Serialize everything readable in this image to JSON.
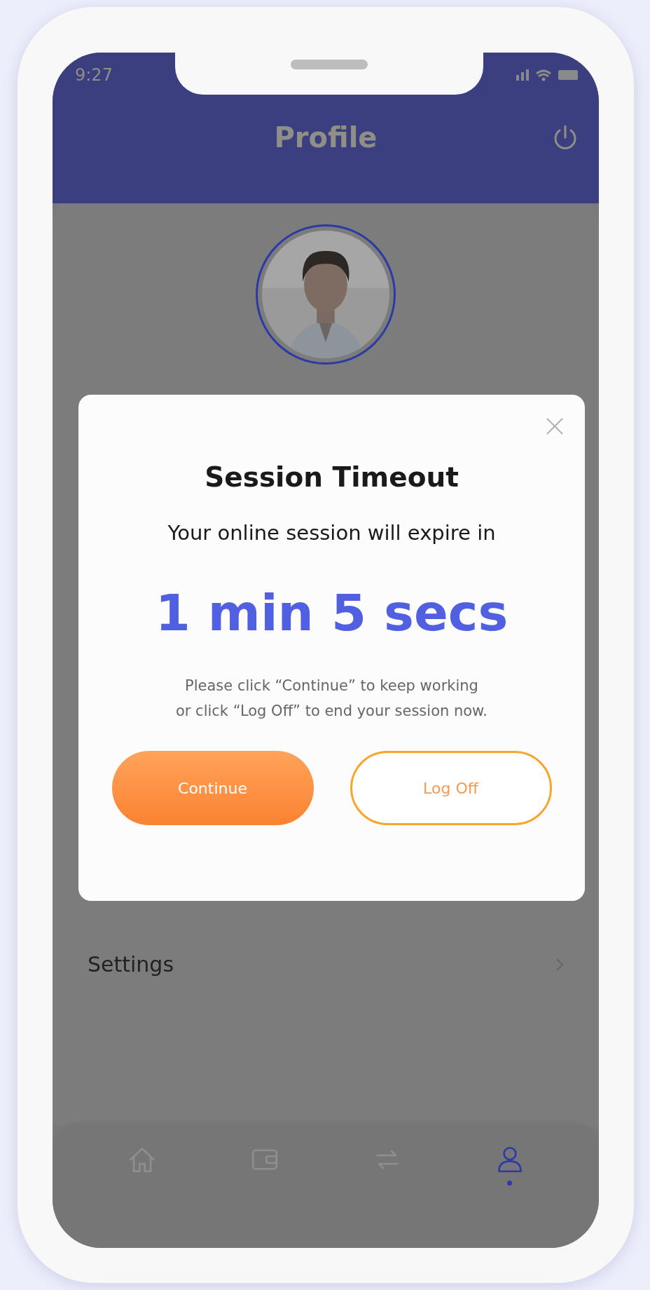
{
  "status_bar": {
    "time": "9:27"
  },
  "header": {
    "title": "Profile"
  },
  "profile": {
    "settings_label": "Settings"
  },
  "dialog": {
    "title": "Session Timeout",
    "message": "Your online session will expire in",
    "countdown": "1 min 5 secs",
    "note_lines": [
      "Please click “Continue” to keep working",
      "or click “Log Off” to end your session now."
    ],
    "buttons": [
      {
        "label": "Continue",
        "kind": "primary"
      },
      {
        "label": "Log Off",
        "kind": "outline"
      }
    ]
  },
  "bottom_nav": [
    {
      "kind": "home",
      "selected": false
    },
    {
      "kind": "wallet",
      "selected": false
    },
    {
      "kind": "transfer",
      "selected": false
    },
    {
      "kind": "profile",
      "selected": true
    }
  ]
}
